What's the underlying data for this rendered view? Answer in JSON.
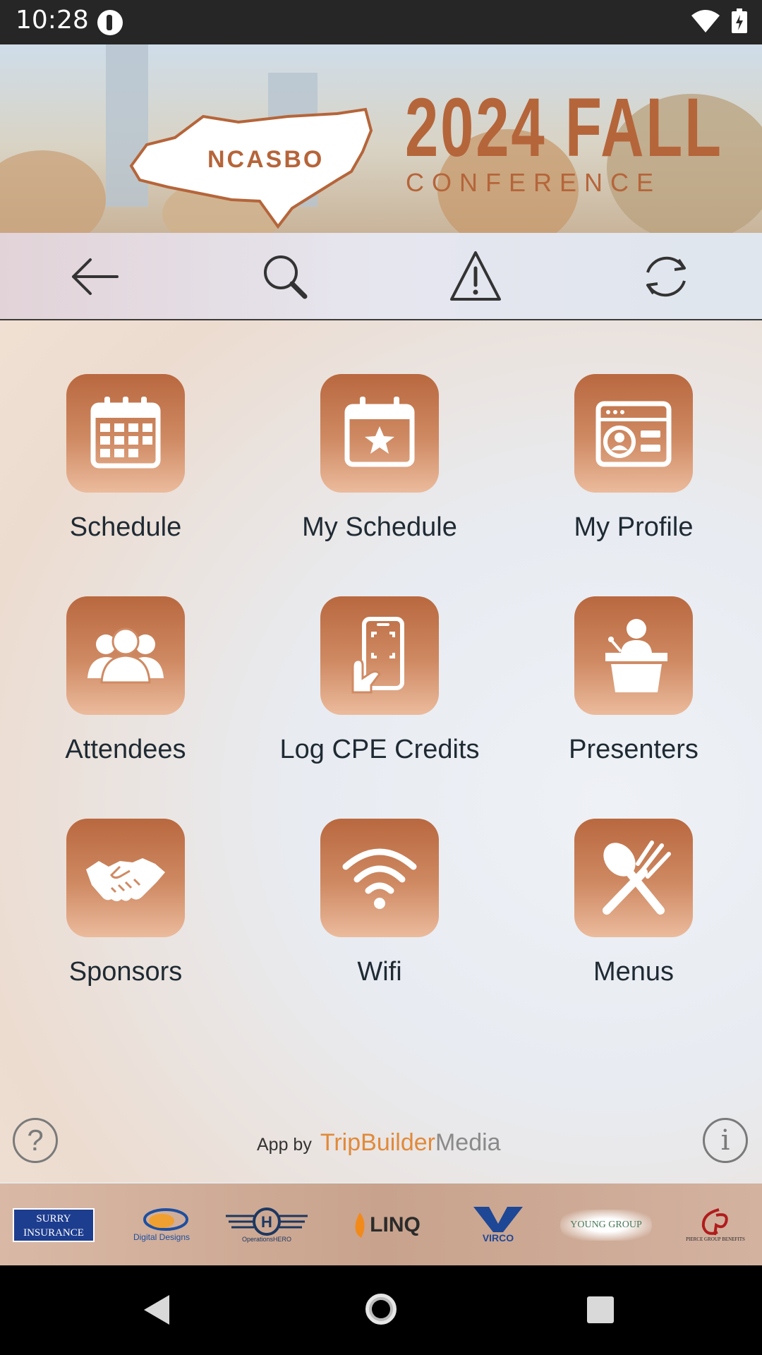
{
  "status_bar": {
    "time": "10:28"
  },
  "banner": {
    "org": "NCASBO",
    "title": "2024 FALL",
    "subtitle": "CONFERENCE"
  },
  "toolbar": {
    "back_icon": "arrow-left-icon",
    "search_icon": "search-icon",
    "alert_icon": "warning-icon",
    "refresh_icon": "refresh-icon"
  },
  "tiles": [
    {
      "label": "Schedule",
      "icon": "calendar-icon"
    },
    {
      "label": "My Schedule",
      "icon": "calendar-star-icon"
    },
    {
      "label": "My Profile",
      "icon": "profile-card-icon"
    },
    {
      "label": "Attendees",
      "icon": "people-icon"
    },
    {
      "label": "Log CPE Credits",
      "icon": "phone-scan-icon"
    },
    {
      "label": "Presenters",
      "icon": "podium-icon"
    },
    {
      "label": "Sponsors",
      "icon": "handshake-icon"
    },
    {
      "label": "Wifi",
      "icon": "wifi-icon"
    },
    {
      "label": "Menus",
      "icon": "utensils-icon"
    },
    {
      "label": "",
      "icon": "location-pin-icon"
    },
    {
      "label": "",
      "icon": "map-icon"
    },
    {
      "label": "",
      "icon": "sunrise-icon"
    }
  ],
  "footer": {
    "help": "?",
    "info": "i",
    "app_by": "App by",
    "brand_1": "TripBuilder",
    "brand_2": "Media"
  },
  "sponsors": [
    {
      "name": "Surry Insurance",
      "line1": "SURRY",
      "line2": "INSURANCE"
    },
    {
      "name": "Digital Designs",
      "text": "Digital Designs"
    },
    {
      "name": "OperationsHERO",
      "text": "OperationsHERO"
    },
    {
      "name": "LINQ",
      "text": "LINQ"
    },
    {
      "name": "VIRCO",
      "text": "VIRCO"
    },
    {
      "name": "Young Group",
      "text": "YOUNG GROUP"
    },
    {
      "name": "Pierce Group Benefits",
      "text": "PIERCE GROUP BENEFITS"
    }
  ],
  "colors": {
    "accent": "#b9683f",
    "tile_gradient_end": "#ebbb9d",
    "text": "#1f2a33"
  }
}
